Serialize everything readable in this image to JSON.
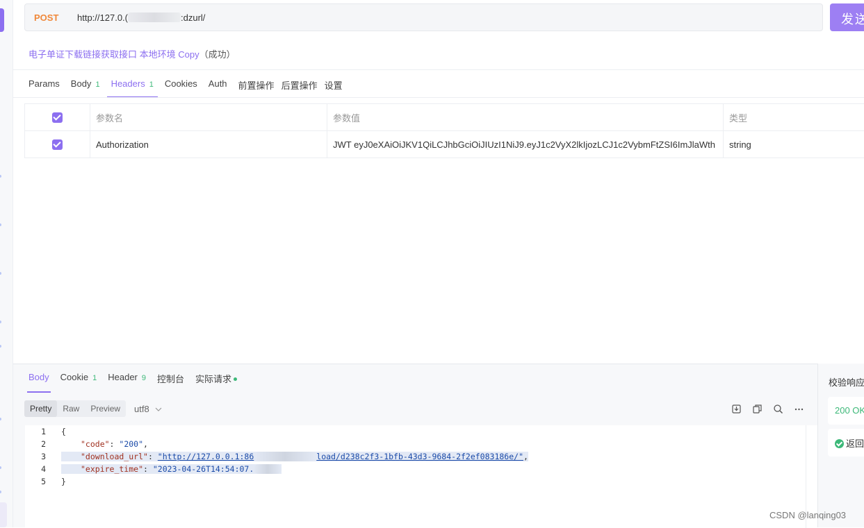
{
  "request": {
    "method": "POST",
    "url_prefix": "http://127.0.(",
    "url_suffix": ":dzurl/",
    "send_label": "发送"
  },
  "api": {
    "name": "电子单证下载链接获取接口 本地环境 Copy",
    "status": "（成功）"
  },
  "tabs": [
    {
      "label": "Params",
      "badge": ""
    },
    {
      "label": "Body",
      "badge": "1"
    },
    {
      "label": "Headers",
      "badge": "1"
    },
    {
      "label": "Cookies",
      "badge": ""
    },
    {
      "label": "Auth",
      "badge": ""
    },
    {
      "label": "前置操作",
      "badge": ""
    },
    {
      "label": "后置操作",
      "badge": ""
    },
    {
      "label": "设置",
      "badge": ""
    }
  ],
  "headers_table": {
    "columns": [
      "参数名",
      "参数值",
      "类型"
    ],
    "rows": [
      {
        "name": "Authorization",
        "value": "JWT eyJ0eXAiOiJKV1QiLCJhbGciOiJIUzI1NiJ9.eyJ1c2VyX2lkIjozLCJ1c2VybmFtZSI6ImJlaWth",
        "type": "string"
      }
    ]
  },
  "response": {
    "tabs": [
      {
        "label": "Body",
        "badge": ""
      },
      {
        "label": "Cookie",
        "badge": "1"
      },
      {
        "label": "Header",
        "badge": "9"
      },
      {
        "label": "控制台",
        "badge": ""
      },
      {
        "label": "实际请求",
        "badge": ""
      }
    ],
    "formats": [
      "Pretty",
      "Raw",
      "Preview"
    ],
    "encoding": "utf8",
    "code_lines": [
      {
        "n": "1",
        "text": "{"
      },
      {
        "n": "2",
        "key": "\"code\"",
        "value": "\"200\""
      },
      {
        "n": "3",
        "key": "\"download_url\"",
        "value_prefix": "\"http://127.0.0.1:86",
        "value_suffix": "load/d238c2f3-1bfb-43d3-9684-2f2ef083186e/\""
      },
      {
        "n": "4",
        "key": "\"expire_time\"",
        "value": "\"2023-04-26T14:54:07."
      },
      {
        "n": "5",
        "text": "}"
      }
    ]
  },
  "side": {
    "title": "校验响应",
    "status": "200 OK",
    "result": "返回"
  },
  "watermark": "CSDN @lanqing03",
  "colors": {
    "accent": "#8c6ff0",
    "method": "#f0883a",
    "success": "#3cb878"
  }
}
